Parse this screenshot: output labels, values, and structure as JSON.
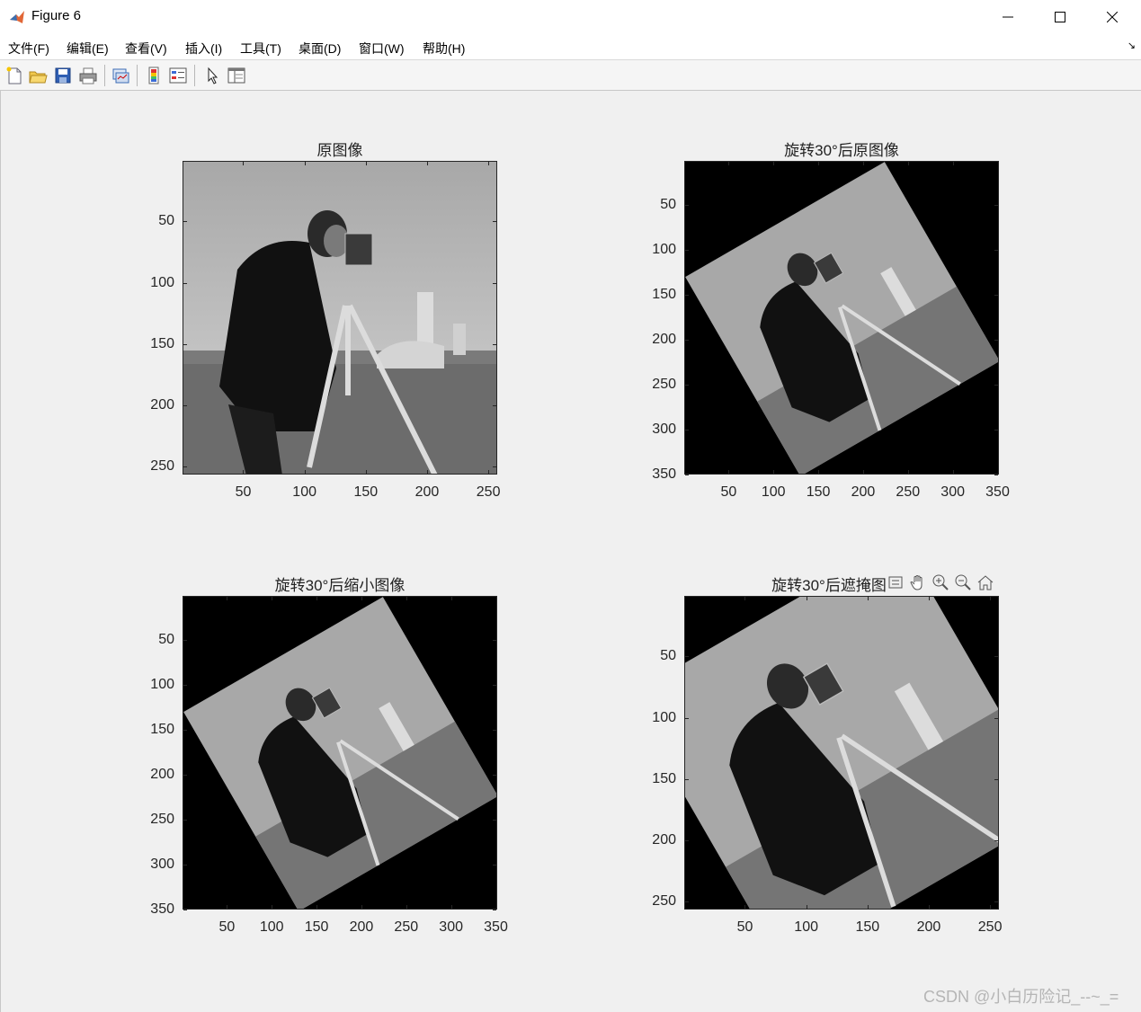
{
  "window": {
    "title": "Figure 6"
  },
  "menu": [
    "文件(F)",
    "编辑(E)",
    "查看(V)",
    "插入(I)",
    "工具(T)",
    "桌面(D)",
    "窗口(W)",
    "帮助(H)"
  ],
  "axes": [
    {
      "title": "原图像",
      "yticks": [
        "50",
        "100",
        "150",
        "200",
        "250"
      ],
      "xticks": [
        "50",
        "100",
        "150",
        "200",
        "250"
      ]
    },
    {
      "title": "旋转30°后原图像",
      "yticks": [
        "50",
        "100",
        "150",
        "200",
        "250",
        "300",
        "350"
      ],
      "xticks": [
        "50",
        "100",
        "150",
        "200",
        "250",
        "300",
        "350"
      ]
    },
    {
      "title": "旋转30°后缩小图像",
      "yticks": [
        "50",
        "100",
        "150",
        "200",
        "250",
        "300",
        "350"
      ],
      "xticks": [
        "50",
        "100",
        "150",
        "200",
        "250",
        "300",
        "350"
      ]
    },
    {
      "title": "旋转30°后遮掩图",
      "yticks": [
        "50",
        "100",
        "150",
        "200",
        "250"
      ],
      "xticks": [
        "50",
        "100",
        "150",
        "200",
        "250"
      ]
    }
  ],
  "watermark": "CSDN @小白历险记_--~_=",
  "icons": [
    "matlab-icon",
    "minimize-icon",
    "maximize-icon",
    "close-icon",
    "new-figure-icon",
    "open-file-icon",
    "save-icon",
    "print-icon",
    "link-plot-icon",
    "insert-colorbar-icon",
    "insert-legend-icon",
    "edit-plot-arrow-icon",
    "property-inspector-icon",
    "export-icon",
    "pan-icon",
    "zoom-in-icon",
    "zoom-out-icon",
    "home-icon"
  ]
}
